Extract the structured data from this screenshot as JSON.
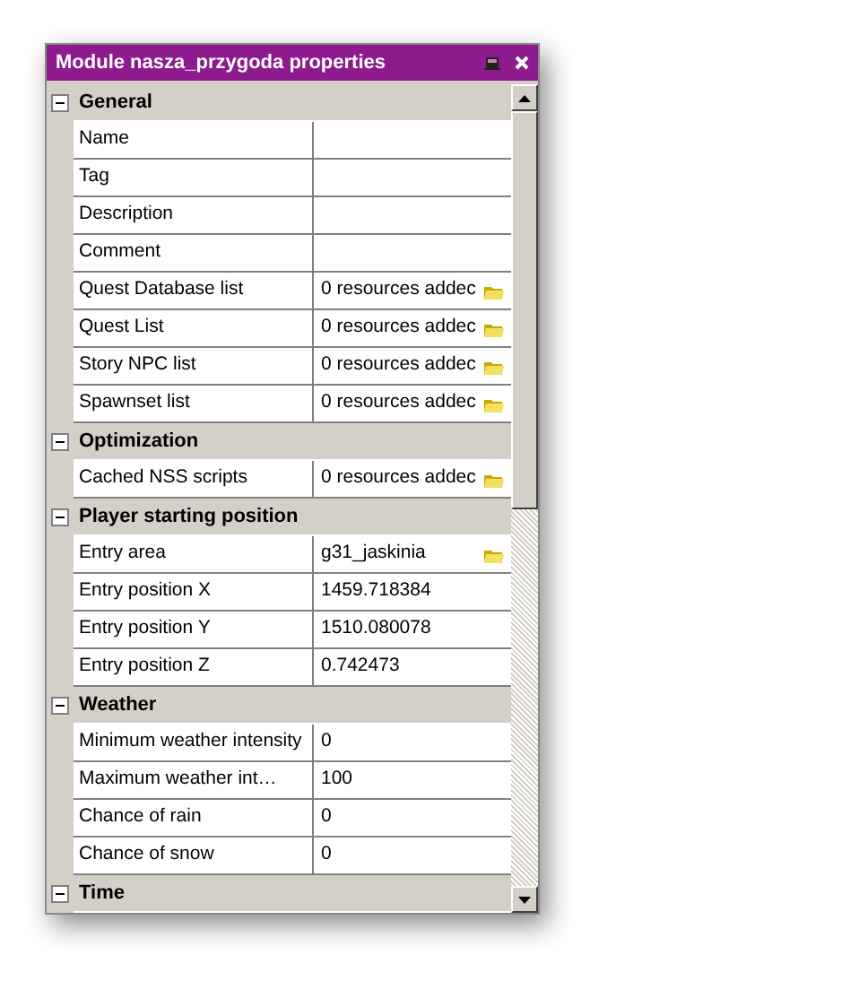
{
  "window": {
    "title": "Module nasza_przygoda properties"
  },
  "categories": [
    {
      "name": "General",
      "expanded": true,
      "properties": [
        {
          "name": "Name",
          "browse": false
        },
        {
          "name": "Tag",
          "browse": false
        },
        {
          "name": "Description",
          "browse": false
        },
        {
          "name": "Comment",
          "browse": false
        },
        {
          "name": "Quest Database list",
          "value": "0 resources addec",
          "browse": true
        },
        {
          "name": "Quest List",
          "value": "0 resources addec",
          "browse": true
        },
        {
          "name": "Story NPC list",
          "value": "0 resources addec",
          "browse": true
        },
        {
          "name": "Spawnset list",
          "value": "0 resources addec",
          "browse": true
        }
      ]
    },
    {
      "name": "Optimization",
      "expanded": true,
      "properties": [
        {
          "name": "Cached NSS scripts",
          "value": "0 resources addec",
          "browse": true
        }
      ]
    },
    {
      "name": "Player starting position",
      "expanded": true,
      "properties": [
        {
          "name": "Entry area",
          "value": "g31_jaskinia",
          "browse": true
        },
        {
          "name": "Entry position X",
          "value": "1459.718384",
          "browse": false
        },
        {
          "name": "Entry position Y",
          "value": "1510.080078",
          "browse": false
        },
        {
          "name": "Entry position Z",
          "value": "0.742473",
          "browse": false
        }
      ]
    },
    {
      "name": "Weather",
      "expanded": true,
      "properties": [
        {
          "name": "Minimum weather intensity",
          "value": "0",
          "browse": false
        },
        {
          "name": "Maximum weather int…",
          "value": "100",
          "browse": false
        },
        {
          "name": "Chance of rain",
          "value": "0",
          "browse": false
        },
        {
          "name": "Chance of snow",
          "value": "0",
          "browse": false
        }
      ]
    },
    {
      "name": "Time",
      "expanded": true
    }
  ]
}
